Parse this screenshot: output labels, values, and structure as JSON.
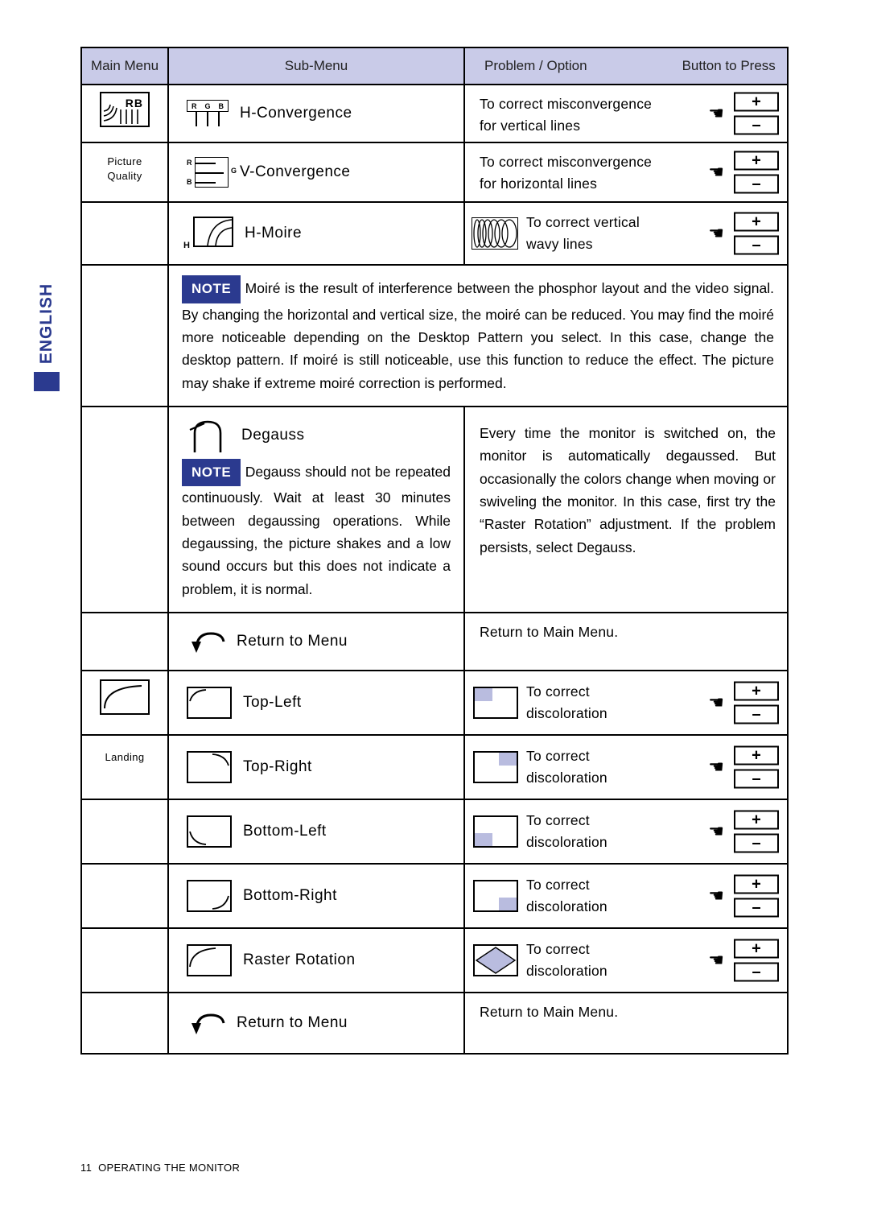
{
  "side_tab": {
    "label": "ENGLISH"
  },
  "table": {
    "header": {
      "main_menu": "Main Menu",
      "sub_menu": "Sub-Menu",
      "problem_option": "Problem / Option",
      "button_to_press": "Button to Press"
    },
    "main_sections": [
      {
        "label_line1": "Picture",
        "label_line2": "Quality",
        "icon": "monitor-rb-icon"
      },
      {
        "label_line1": "Landing",
        "label_line2": "",
        "icon": "monitor-landing-icon"
      }
    ],
    "rows": [
      {
        "sub_menu": "H-Convergence",
        "icon": "rgb-vertical-lines-icon",
        "problem_line1": "To correct misconvergence",
        "problem_line2": "for vertical lines",
        "buttons": [
          "+",
          "–"
        ]
      },
      {
        "sub_menu": "V-Convergence",
        "icon": "rgb-horizontal-lines-icon",
        "problem_line1": "To correct misconvergence",
        "problem_line2": "for horizontal lines",
        "buttons": [
          "+",
          "–"
        ]
      },
      {
        "sub_menu": "H-Moire",
        "icon": "h-moire-icon",
        "problem_line1": "To correct vertical",
        "problem_line2": "wavy lines",
        "problem_icon": "moire-pattern-icon",
        "buttons": [
          "+",
          "–"
        ]
      }
    ],
    "note_moire": {
      "badge": "NOTE",
      "text": "Moiré is the result of interference between the phosphor layout and the video signal. By changing the horizontal and vertical size, the moiré can be reduced. You may find the moiré more noticeable depending on the Desktop Pattern you select. In this case, change the desktop pattern. If moiré is still noticeable, use this function to reduce the effect. The picture may shake if extreme moiré correction is performed."
    },
    "degauss_row": {
      "sub_menu": "Degauss",
      "icon": "degauss-horseshoe-icon",
      "note_badge": "NOTE",
      "note_text": "Degauss should not be repeated continuously. Wait at least 30 minutes between degaussing operations. While degaussing, the picture shakes and a low sound occurs but this does not indicate a problem, it is normal.",
      "problem_text": "Every time the monitor is switched on, the monitor is automatically degaussed. But occasionally the colors change when moving or swiveling the monitor. In this case, first try the “Raster Rotation” adjustment. If the problem persists, select Degauss."
    },
    "return_row_1": {
      "sub_menu": "Return to Menu",
      "icon": "return-arrow-icon",
      "problem": "Return to Main Menu."
    },
    "landing_rows": [
      {
        "sub_menu": "Top-Left",
        "icon": "thumb-top-left-icon",
        "problem_icon": "thumb-top-left-shaded-icon",
        "problem_line1": "To correct",
        "problem_line2": "discoloration",
        "buttons": [
          "+",
          "–"
        ]
      },
      {
        "sub_menu": "Top-Right",
        "icon": "thumb-top-right-icon",
        "problem_icon": "thumb-top-right-shaded-icon",
        "problem_line1": "To correct",
        "problem_line2": "discoloration",
        "buttons": [
          "+",
          "–"
        ]
      },
      {
        "sub_menu": "Bottom-Left",
        "icon": "thumb-bottom-left-icon",
        "problem_icon": "thumb-bottom-left-shaded-icon",
        "problem_line1": "To correct",
        "problem_line2": "discoloration",
        "buttons": [
          "+",
          "–"
        ]
      },
      {
        "sub_menu": "Bottom-Right",
        "icon": "thumb-bottom-right-icon",
        "problem_icon": "thumb-bottom-right-shaded-icon",
        "problem_line1": "To correct",
        "problem_line2": "discoloration",
        "buttons": [
          "+",
          "–"
        ]
      },
      {
        "sub_menu": "Raster Rotation",
        "icon": "thumb-raster-rotation-icon",
        "problem_icon": "thumb-diamond-shaded-icon",
        "problem_line1": "To correct",
        "problem_line2": "discoloration",
        "buttons": [
          "+",
          "–"
        ]
      }
    ],
    "return_row_2": {
      "sub_menu": "Return to Menu",
      "icon": "return-arrow-icon",
      "problem": "Return to Main Menu."
    }
  },
  "rgb_icon_labels": {
    "r": "R",
    "g": "G",
    "b": "B"
  },
  "h_label": "H",
  "monitor_rb_label": "RB",
  "footer": {
    "page": "11",
    "title": "OPERATING THE MONITOR"
  },
  "colors": {
    "header_bg": "#c9cbe8",
    "accent": "#2b3a8f",
    "shade": "#b9bcdf"
  }
}
